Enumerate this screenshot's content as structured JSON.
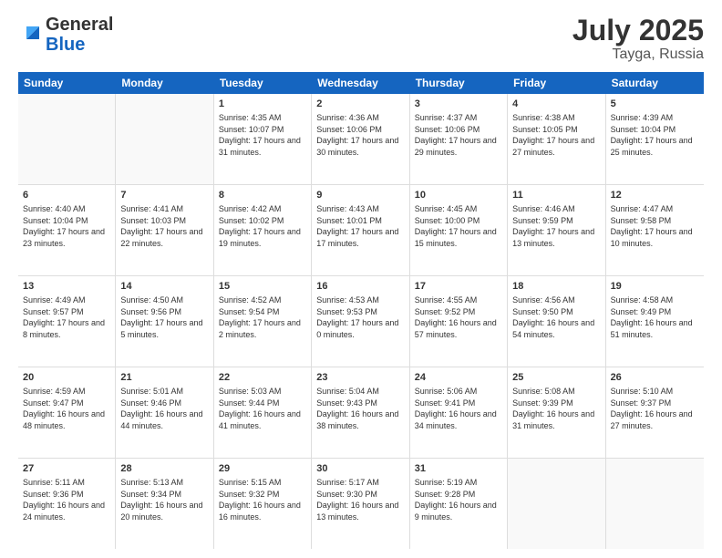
{
  "logo": {
    "general": "General",
    "blue": "Blue"
  },
  "title": "July 2025",
  "location": "Tayga, Russia",
  "header_days": [
    "Sunday",
    "Monday",
    "Tuesday",
    "Wednesday",
    "Thursday",
    "Friday",
    "Saturday"
  ],
  "weeks": [
    [
      {
        "day": "",
        "empty": true
      },
      {
        "day": "",
        "empty": true
      },
      {
        "day": "1",
        "sunrise": "Sunrise: 4:35 AM",
        "sunset": "Sunset: 10:07 PM",
        "daylight": "Daylight: 17 hours and 31 minutes."
      },
      {
        "day": "2",
        "sunrise": "Sunrise: 4:36 AM",
        "sunset": "Sunset: 10:06 PM",
        "daylight": "Daylight: 17 hours and 30 minutes."
      },
      {
        "day": "3",
        "sunrise": "Sunrise: 4:37 AM",
        "sunset": "Sunset: 10:06 PM",
        "daylight": "Daylight: 17 hours and 29 minutes."
      },
      {
        "day": "4",
        "sunrise": "Sunrise: 4:38 AM",
        "sunset": "Sunset: 10:05 PM",
        "daylight": "Daylight: 17 hours and 27 minutes."
      },
      {
        "day": "5",
        "sunrise": "Sunrise: 4:39 AM",
        "sunset": "Sunset: 10:04 PM",
        "daylight": "Daylight: 17 hours and 25 minutes."
      }
    ],
    [
      {
        "day": "6",
        "sunrise": "Sunrise: 4:40 AM",
        "sunset": "Sunset: 10:04 PM",
        "daylight": "Daylight: 17 hours and 23 minutes."
      },
      {
        "day": "7",
        "sunrise": "Sunrise: 4:41 AM",
        "sunset": "Sunset: 10:03 PM",
        "daylight": "Daylight: 17 hours and 22 minutes."
      },
      {
        "day": "8",
        "sunrise": "Sunrise: 4:42 AM",
        "sunset": "Sunset: 10:02 PM",
        "daylight": "Daylight: 17 hours and 19 minutes."
      },
      {
        "day": "9",
        "sunrise": "Sunrise: 4:43 AM",
        "sunset": "Sunset: 10:01 PM",
        "daylight": "Daylight: 17 hours and 17 minutes."
      },
      {
        "day": "10",
        "sunrise": "Sunrise: 4:45 AM",
        "sunset": "Sunset: 10:00 PM",
        "daylight": "Daylight: 17 hours and 15 minutes."
      },
      {
        "day": "11",
        "sunrise": "Sunrise: 4:46 AM",
        "sunset": "Sunset: 9:59 PM",
        "daylight": "Daylight: 17 hours and 13 minutes."
      },
      {
        "day": "12",
        "sunrise": "Sunrise: 4:47 AM",
        "sunset": "Sunset: 9:58 PM",
        "daylight": "Daylight: 17 hours and 10 minutes."
      }
    ],
    [
      {
        "day": "13",
        "sunrise": "Sunrise: 4:49 AM",
        "sunset": "Sunset: 9:57 PM",
        "daylight": "Daylight: 17 hours and 8 minutes."
      },
      {
        "day": "14",
        "sunrise": "Sunrise: 4:50 AM",
        "sunset": "Sunset: 9:56 PM",
        "daylight": "Daylight: 17 hours and 5 minutes."
      },
      {
        "day": "15",
        "sunrise": "Sunrise: 4:52 AM",
        "sunset": "Sunset: 9:54 PM",
        "daylight": "Daylight: 17 hours and 2 minutes."
      },
      {
        "day": "16",
        "sunrise": "Sunrise: 4:53 AM",
        "sunset": "Sunset: 9:53 PM",
        "daylight": "Daylight: 17 hours and 0 minutes."
      },
      {
        "day": "17",
        "sunrise": "Sunrise: 4:55 AM",
        "sunset": "Sunset: 9:52 PM",
        "daylight": "Daylight: 16 hours and 57 minutes."
      },
      {
        "day": "18",
        "sunrise": "Sunrise: 4:56 AM",
        "sunset": "Sunset: 9:50 PM",
        "daylight": "Daylight: 16 hours and 54 minutes."
      },
      {
        "day": "19",
        "sunrise": "Sunrise: 4:58 AM",
        "sunset": "Sunset: 9:49 PM",
        "daylight": "Daylight: 16 hours and 51 minutes."
      }
    ],
    [
      {
        "day": "20",
        "sunrise": "Sunrise: 4:59 AM",
        "sunset": "Sunset: 9:47 PM",
        "daylight": "Daylight: 16 hours and 48 minutes."
      },
      {
        "day": "21",
        "sunrise": "Sunrise: 5:01 AM",
        "sunset": "Sunset: 9:46 PM",
        "daylight": "Daylight: 16 hours and 44 minutes."
      },
      {
        "day": "22",
        "sunrise": "Sunrise: 5:03 AM",
        "sunset": "Sunset: 9:44 PM",
        "daylight": "Daylight: 16 hours and 41 minutes."
      },
      {
        "day": "23",
        "sunrise": "Sunrise: 5:04 AM",
        "sunset": "Sunset: 9:43 PM",
        "daylight": "Daylight: 16 hours and 38 minutes."
      },
      {
        "day": "24",
        "sunrise": "Sunrise: 5:06 AM",
        "sunset": "Sunset: 9:41 PM",
        "daylight": "Daylight: 16 hours and 34 minutes."
      },
      {
        "day": "25",
        "sunrise": "Sunrise: 5:08 AM",
        "sunset": "Sunset: 9:39 PM",
        "daylight": "Daylight: 16 hours and 31 minutes."
      },
      {
        "day": "26",
        "sunrise": "Sunrise: 5:10 AM",
        "sunset": "Sunset: 9:37 PM",
        "daylight": "Daylight: 16 hours and 27 minutes."
      }
    ],
    [
      {
        "day": "27",
        "sunrise": "Sunrise: 5:11 AM",
        "sunset": "Sunset: 9:36 PM",
        "daylight": "Daylight: 16 hours and 24 minutes."
      },
      {
        "day": "28",
        "sunrise": "Sunrise: 5:13 AM",
        "sunset": "Sunset: 9:34 PM",
        "daylight": "Daylight: 16 hours and 20 minutes."
      },
      {
        "day": "29",
        "sunrise": "Sunrise: 5:15 AM",
        "sunset": "Sunset: 9:32 PM",
        "daylight": "Daylight: 16 hours and 16 minutes."
      },
      {
        "day": "30",
        "sunrise": "Sunrise: 5:17 AM",
        "sunset": "Sunset: 9:30 PM",
        "daylight": "Daylight: 16 hours and 13 minutes."
      },
      {
        "day": "31",
        "sunrise": "Sunrise: 5:19 AM",
        "sunset": "Sunset: 9:28 PM",
        "daylight": "Daylight: 16 hours and 9 minutes."
      },
      {
        "day": "",
        "empty": true
      },
      {
        "day": "",
        "empty": true
      }
    ]
  ]
}
